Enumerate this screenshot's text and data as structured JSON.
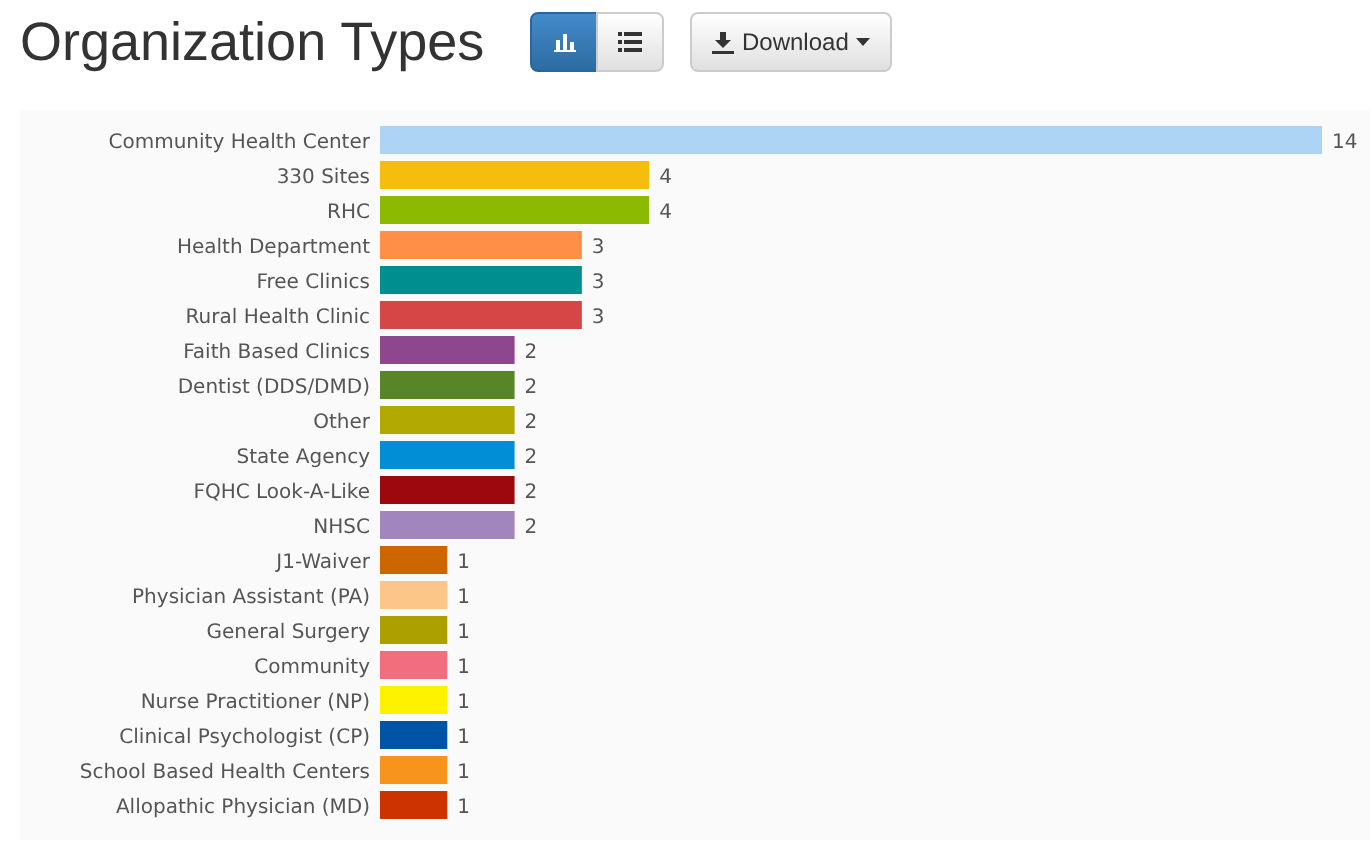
{
  "title": "Organization Types",
  "view_toggle": [
    {
      "kind": "chart",
      "selected": true
    },
    {
      "kind": "list",
      "selected": false
    }
  ],
  "download_button": {
    "label": "Download"
  },
  "chart_data": {
    "type": "bar",
    "orientation": "horizontal",
    "data_labels": true,
    "categories": [
      "Community Health Center",
      "330 Sites",
      "RHC",
      "Health Department",
      "Free Clinics",
      "Rural Health Clinic",
      "Faith Based Clinics",
      "Dentist (DDS/DMD)",
      "Other",
      "State Agency",
      "FQHC Look-A-Like",
      "NHSC",
      "J1-Waiver",
      "Physician Assistant (PA)",
      "General Surgery",
      "Community",
      "Nurse Practitioner (NP)",
      "Clinical Psychologist (CP)",
      "School Based Health Centers",
      "Allopathic Physician (MD)"
    ],
    "values": [
      14,
      4,
      4,
      3,
      3,
      3,
      2,
      2,
      2,
      2,
      2,
      2,
      1,
      1,
      1,
      1,
      1,
      1,
      1,
      1
    ],
    "colors": [
      "#aed4f5",
      "#f5bd0e",
      "#8bba00",
      "#ff8e46",
      "#008e8e",
      "#d64646",
      "#8e468e",
      "#588526",
      "#b3aa00",
      "#008ed6",
      "#9d080d",
      "#a186be",
      "#cc6600",
      "#fdc689",
      "#aba000",
      "#f26d7d",
      "#fff200",
      "#0054a6",
      "#f7941c",
      "#cc3300"
    ]
  }
}
